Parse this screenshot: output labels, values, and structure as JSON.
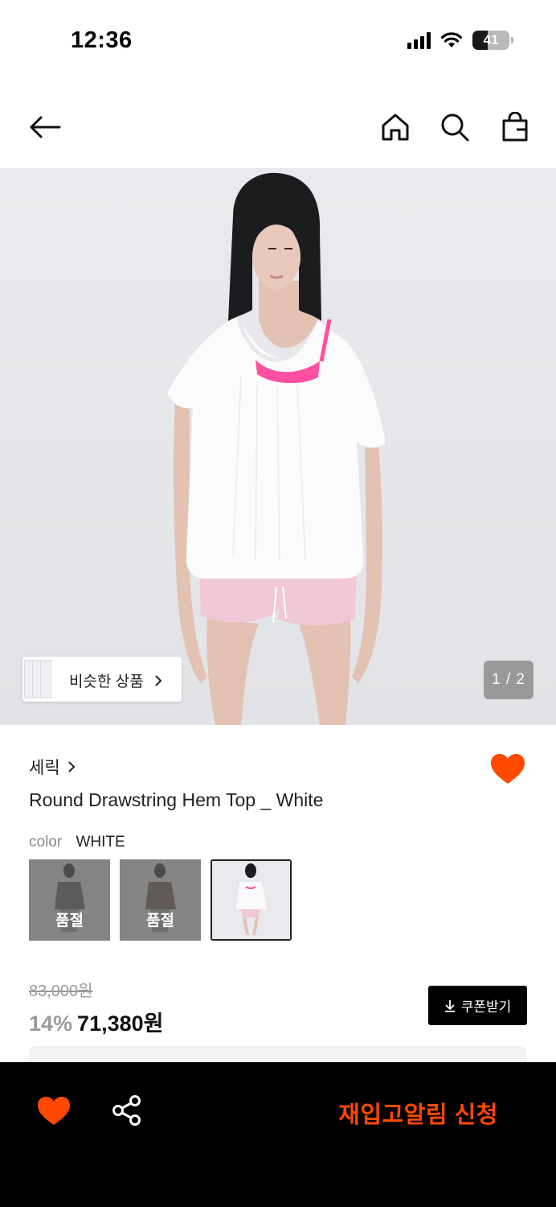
{
  "status_bar": {
    "time": "12:36",
    "battery_level": "41",
    "battery_fraction": 0.41,
    "icons": [
      "signal-icon",
      "wifi-icon",
      "battery-icon"
    ]
  },
  "nav": {
    "icons": [
      "back-arrow-icon",
      "home-icon",
      "search-icon",
      "shopping-bag-icon"
    ]
  },
  "gallery": {
    "similar_label": "비슷한 상품",
    "page_indicator": "1 / 2"
  },
  "product": {
    "brand": "세릭",
    "name": "Round Drawstring Hem Top _ White",
    "color_label": "color",
    "color_value": "WHITE",
    "swatches": [
      {
        "status": "품절",
        "selected": false
      },
      {
        "status": "품절",
        "selected": false
      },
      {
        "status": "",
        "selected": true
      }
    ],
    "original_price": "83,000원",
    "discount": "14%",
    "sale_price": "71,380원",
    "coupon_label": "쿠폰받기"
  },
  "bottom_bar": {
    "restock_label": "재입고알림 신청"
  },
  "colors": {
    "accent": "#FF4800",
    "bottom_bar_bg": "#000000",
    "hero_bg": "#E6E7EA"
  }
}
